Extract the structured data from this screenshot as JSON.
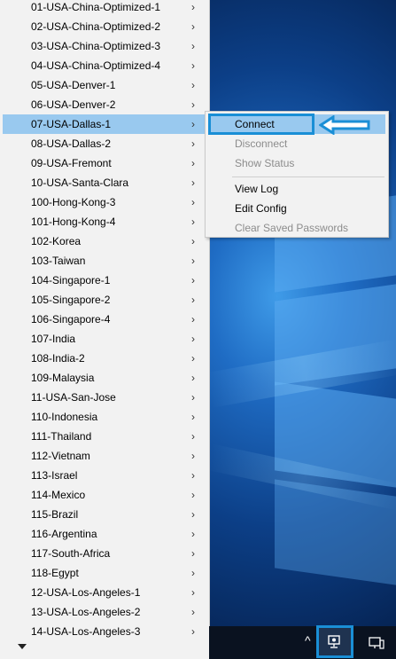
{
  "menu": {
    "items": [
      {
        "label": "01-USA-China-Optimized-1"
      },
      {
        "label": "02-USA-China-Optimized-2"
      },
      {
        "label": "03-USA-China-Optimized-3"
      },
      {
        "label": "04-USA-China-Optimized-4"
      },
      {
        "label": "05-USA-Denver-1"
      },
      {
        "label": "06-USA-Denver-2"
      },
      {
        "label": "07-USA-Dallas-1"
      },
      {
        "label": "08-USA-Dallas-2"
      },
      {
        "label": "09-USA-Fremont"
      },
      {
        "label": "10-USA-Santa-Clara"
      },
      {
        "label": "100-Hong-Kong-3"
      },
      {
        "label": "101-Hong-Kong-4"
      },
      {
        "label": "102-Korea"
      },
      {
        "label": "103-Taiwan"
      },
      {
        "label": "104-Singapore-1"
      },
      {
        "label": "105-Singapore-2"
      },
      {
        "label": "106-Singapore-4"
      },
      {
        "label": "107-India"
      },
      {
        "label": "108-India-2"
      },
      {
        "label": "109-Malaysia"
      },
      {
        "label": "11-USA-San-Jose"
      },
      {
        "label": "110-Indonesia"
      },
      {
        "label": "111-Thailand"
      },
      {
        "label": "112-Vietnam"
      },
      {
        "label": "113-Israel"
      },
      {
        "label": "114-Mexico"
      },
      {
        "label": "115-Brazil"
      },
      {
        "label": "116-Argentina"
      },
      {
        "label": "117-South-Africa"
      },
      {
        "label": "118-Egypt"
      },
      {
        "label": "12-USA-Los-Angeles-1"
      },
      {
        "label": "13-USA-Los-Angeles-2"
      },
      {
        "label": "14-USA-Los-Angeles-3"
      }
    ],
    "chevron": "›"
  },
  "submenu": {
    "connect": "Connect",
    "disconnect": "Disconnect",
    "show_status": "Show Status",
    "view_log": "View Log",
    "edit_config": "Edit Config",
    "clear_passwords": "Clear Saved Passwords"
  },
  "taskbar": {
    "tray_chevron": "^"
  },
  "colors": {
    "selection": "#99c9ef",
    "annotation": "#1a8fd6"
  }
}
